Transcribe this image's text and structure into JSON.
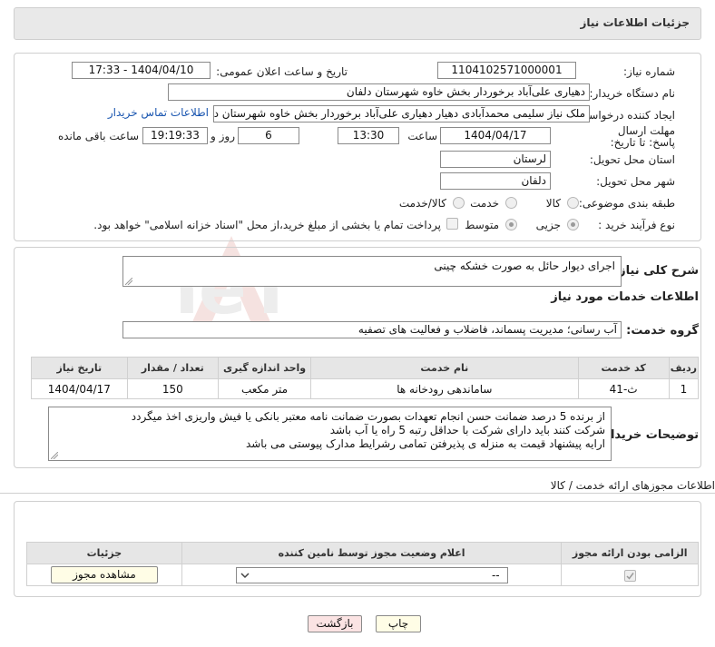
{
  "header": {
    "title": "جزئیات اطلاعات نیاز"
  },
  "form": {
    "need_number_label": "شماره نیاز:",
    "need_number": "1104102571000001",
    "announce_label": "تاریخ و ساعت اعلان عمومی:",
    "announce_value": "1404/04/10 - 17:33",
    "buyer_org_label": "نام دستگاه خریدار:",
    "buyer_org": "دهیاری علی‌آباد برخوردار بخش خاوه شهرستان دلفان",
    "requester_label": "ایجاد کننده درخواست:",
    "requester": "ملک نیاز سلیمی محمدآبادی دهیار دهیاری علی‌آباد برخوردار بخش خاوه شهرستان دلفان",
    "contact_link": "اطلاعات تماس خریدار",
    "deadline_label": "مهلت ارسال پاسخ: تا تاریخ:",
    "deadline_date": "1404/04/17",
    "time_label": "ساعت",
    "deadline_time": "13:30",
    "days_value": "6",
    "days_label": "روز و",
    "remaining_time": "19:19:33",
    "remaining_label": "ساعت باقی مانده",
    "province_label": "استان محل تحویل:",
    "province": "لرستان",
    "city_label": "شهر محل تحویل:",
    "city": "دلفان",
    "category_label": "طبقه بندی موضوعی:",
    "category_options": [
      "کالا",
      "خدمت",
      "کالا/خدمت"
    ],
    "process_label": "نوع فرآیند خرید :",
    "process_options": [
      "جزیی",
      "متوسط"
    ],
    "payment_note": "پرداخت تمام یا بخشی از مبلغ خرید،از محل \"اسناد خزانه اسلامی\" خواهد بود."
  },
  "need": {
    "summary_label": "شرح کلی نیاز:",
    "summary": "اجرای دیوار حائل به صورت خشکه چینی",
    "services_title": "اطلاعات خدمات مورد نیاز",
    "group_label": "گروه خدمت:",
    "group_value": "آب رسانی؛ مدیریت پسماند، فاضلاب و فعالیت های تصفیه",
    "table": {
      "headers": [
        "ردیف",
        "کد خدمت",
        "نام خدمت",
        "واحد اندازه گیری",
        "تعداد / مقدار",
        "تاریخ نیاز"
      ],
      "rows": [
        [
          "1",
          "ث-41",
          "ساماندهی رودخانه ها",
          "متر مکعب",
          "150",
          "1404/04/17"
        ]
      ]
    },
    "buyer_notes_label": "توضیحات خریدار:",
    "buyer_notes": [
      "از برنده 5 درصد ضمانت حسن انجام تعهدات بصورت ضمانت نامه معتبر بانکی یا فیش واریزی اخذ میگردد",
      "شرکت کنند باید دارای شرکت با حداقل رتبه 5 راه یا آب باشد",
      "ارایه پیشنهاد قیمت به منزله ی پذیرفتن تمامی رشرایط مدارک پیوستی می باشد"
    ]
  },
  "permits": {
    "title": "اطلاعات مجوزهای ارائه خدمت / کالا",
    "headers": [
      "الزامی بودن ارائه مجوز",
      "اعلام وضعیت مجوز توسط نامین کننده",
      "جزئیات"
    ],
    "select_value": "--",
    "view_button": "مشاهده مجوز"
  },
  "footer": {
    "print": "چاپ",
    "back": "بازگشت"
  },
  "watermark": {
    "text": "AriaTender.neT"
  },
  "colors": {
    "link": "#1a56b0",
    "back_button_bg": "#fbe3e3",
    "print_button_bg": "#fffde6",
    "watermark": "#c0392b"
  }
}
